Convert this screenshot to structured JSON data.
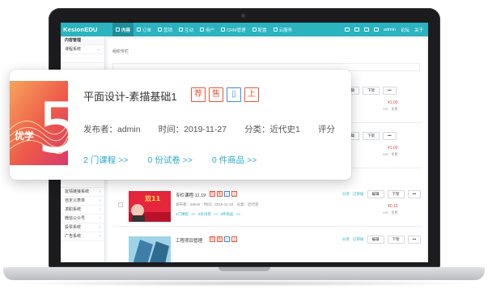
{
  "topbar": {
    "brand": "KesionEDU",
    "nav": [
      {
        "label": "内容",
        "active": true
      },
      {
        "label": "订单",
        "active": false
      },
      {
        "label": "营销",
        "active": false
      },
      {
        "label": "互动",
        "active": false
      },
      {
        "label": "用户",
        "active": false
      },
      {
        "label": "CRM管理",
        "active": false
      },
      {
        "label": "配置",
        "active": false
      },
      {
        "label": "云服务",
        "active": false
      }
    ],
    "user": "admin",
    "links": [
      "论坛",
      "关于"
    ]
  },
  "sidebar": {
    "items": [
      {
        "label": "内容管理",
        "head": true
      },
      {
        "label": "课程系统",
        "arrow": "⌄"
      },
      {
        "label": "",
        "arrow": ""
      },
      {
        "label": "",
        "arrow": ""
      },
      {
        "label": "",
        "arrow": ""
      },
      {
        "label": "",
        "arrow": ""
      },
      {
        "label": "",
        "arrow": ""
      },
      {
        "label": "",
        "arrow": ""
      },
      {
        "label": "",
        "arrow": ""
      },
      {
        "label": "",
        "arrow": ""
      },
      {
        "label": "",
        "arrow": ""
      },
      {
        "label": "",
        "arrow": ""
      },
      {
        "label": "",
        "arrow": ""
      },
      {
        "label": "",
        "arrow": ""
      },
      {
        "label": "",
        "arrow": ""
      },
      {
        "label": "",
        "arrow": ""
      },
      {
        "label": "",
        "arrow": ""
      },
      {
        "label": "友情链接系统",
        "arrow": "›"
      },
      {
        "label": "自定义表单",
        "arrow": "›"
      },
      {
        "label": "求职系统",
        "arrow": "›"
      },
      {
        "label": "微信公众号",
        "arrow": "›"
      },
      {
        "label": "投票系统",
        "arrow": "›"
      },
      {
        "label": "广告系统",
        "arrow": "›"
      }
    ]
  },
  "content": {
    "breadcrumb": "组织专栏",
    "rows": [
      {
        "title": "",
        "meta": "",
        "links": "",
        "ops": {
          "share": "",
          "audit": "",
          "edit": "编辑",
          "offline": "下架",
          "more": "•••"
        },
        "price": "¥1.00",
        "vip": "VIP：免费"
      },
      {
        "title": "",
        "meta": "",
        "links": "",
        "ops": {
          "share": "",
          "audit": "",
          "edit": "编辑",
          "offline": "下架",
          "more": "•••"
        },
        "price": "¥1.00",
        "vip": "VIP：免费"
      },
      {
        "title": "专栏课程-11.19",
        "meta": "发布者：admin　时间：2019-11-18　分类：近代史",
        "links": "2门课程 >>  0份试卷 >>  0件商品 >>",
        "ops": {
          "share": "分享",
          "audit": "已审核",
          "edit": "编辑",
          "offline": "下架",
          "more": "•••"
        },
        "price": "¥0.10",
        "vip": "VIP：免费"
      },
      {
        "title": "工程项目管理",
        "meta": "",
        "links": "",
        "ops": {
          "share": "分享",
          "audit": "已审核",
          "edit": "编辑",
          "offline": "下架",
          "more": "•••"
        },
        "price": "",
        "vip": ""
      }
    ]
  },
  "popover": {
    "title": "平面设计-素描基础1",
    "badges": [
      {
        "text": "荐",
        "color": "#e8573c"
      },
      {
        "text": "售",
        "color": "#e8573c"
      },
      {
        "text": "▯",
        "color": "#3c8de8"
      },
      {
        "text": "上",
        "color": "#e8573c"
      }
    ],
    "publisher": "发布者：admin",
    "time": "时间：2019-11-27",
    "category": "分类：近代史1",
    "review": "评分",
    "links": [
      "2 门课程 >>",
      "0 份试卷 >>",
      "0 件商品 >>"
    ],
    "thumb_text": "5",
    "thumb_caption": "优学"
  },
  "colors": {
    "accent": "#2bb3c0",
    "badge_red": "#e8573c",
    "link": "#2aa9c5"
  }
}
